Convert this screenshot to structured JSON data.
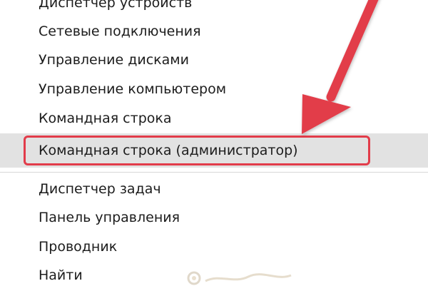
{
  "menu": {
    "items": [
      {
        "label": "Диспетчер устройств"
      },
      {
        "label": "Сетевые подключения"
      },
      {
        "label": "Управление дисками"
      },
      {
        "label": "Управление компьютером"
      },
      {
        "label": "Командная строка"
      },
      {
        "label": "Командная строка (администратор)"
      },
      {
        "label": "Диспетчер задач"
      },
      {
        "label": "Панель управления"
      },
      {
        "label": "Проводник"
      },
      {
        "label": "Найти"
      }
    ]
  },
  "annotation": {
    "arrow_color": "#e23c4a",
    "highlight_color": "#e23c4a"
  },
  "colors": {
    "hover_background": "#e2e2e2",
    "text": "#1c1c1c"
  }
}
